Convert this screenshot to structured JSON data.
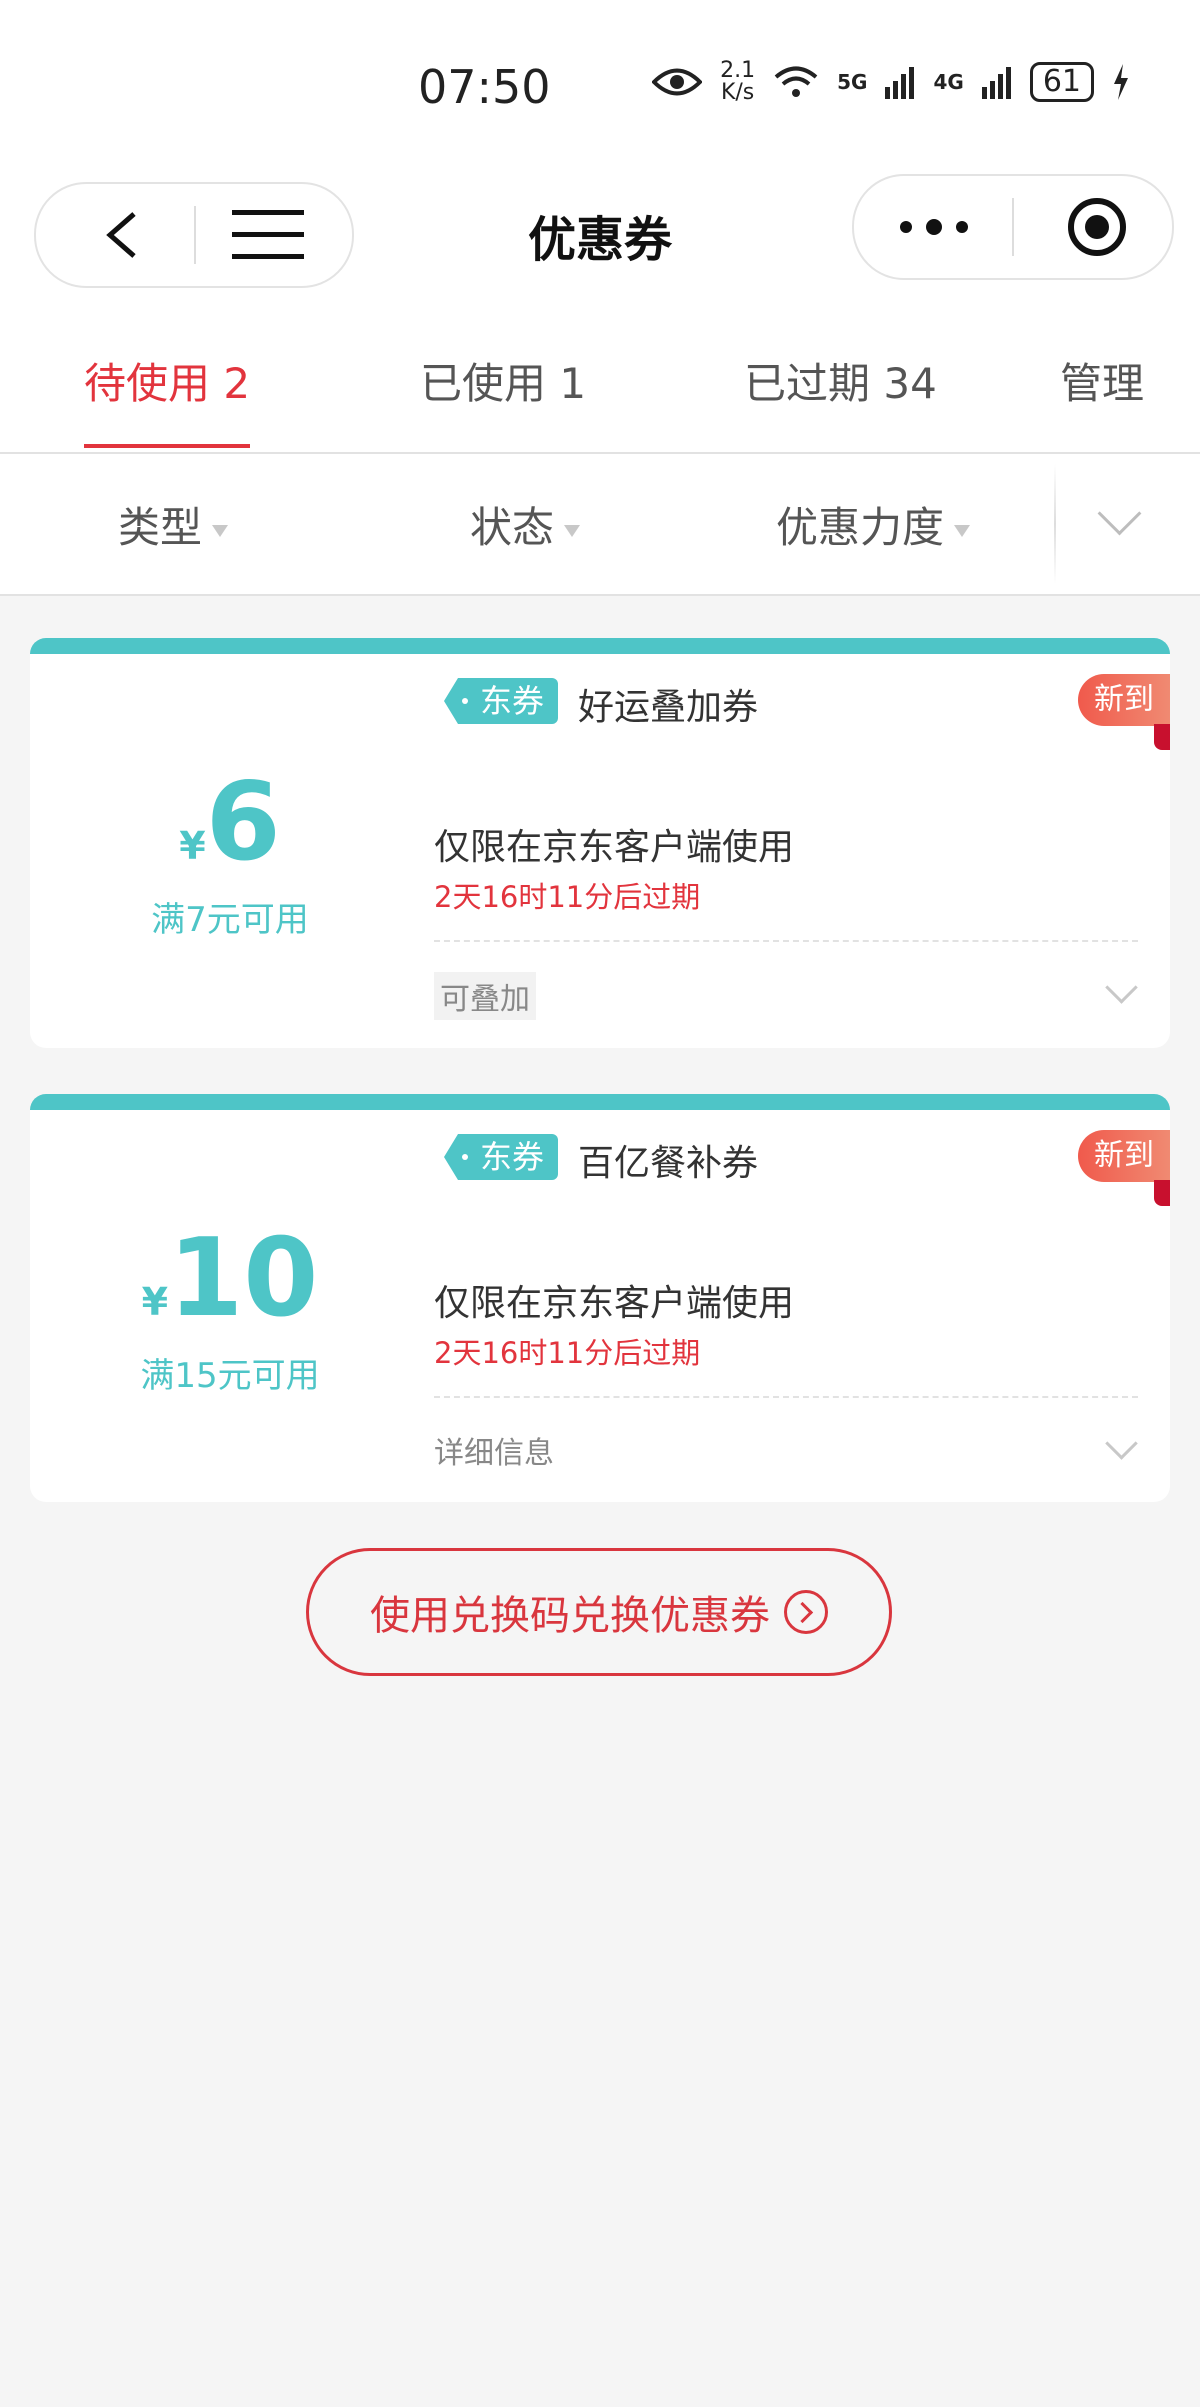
{
  "status_bar": {
    "time": "07:50",
    "net_speed_value": "2.1",
    "net_speed_unit": "K/s",
    "signal_5g": "5G",
    "signal_4g": "4G",
    "battery": "61"
  },
  "nav": {
    "title": "优惠券",
    "icons": [
      "back-icon",
      "menu-icon",
      "more-icon",
      "target-icon"
    ]
  },
  "tabs": [
    {
      "label": "待使用 2",
      "active": true
    },
    {
      "label": "已使用 1",
      "active": false
    },
    {
      "label": "已过期 34",
      "active": false
    },
    {
      "label": "管理",
      "active": false
    }
  ],
  "filters": [
    "类型",
    "状态",
    "优惠力度"
  ],
  "coupons": [
    {
      "tag": "东券",
      "name": "好运叠加券",
      "badge": "新到",
      "currency": "¥",
      "amount": "6",
      "condition": "满7元可用",
      "desc": "仅限在京东客户端使用",
      "expire": "2天16时11分后过期",
      "footer": "可叠加"
    },
    {
      "tag": "东券",
      "name": "百亿餐补券",
      "badge": "新到",
      "currency": "¥",
      "amount": "10",
      "condition": "满15元可用",
      "desc": "仅限在京东客户端使用",
      "expire": "2天16时11分后过期",
      "footer": "详细信息"
    }
  ],
  "redeem_label": "使用兑换码兑换优惠券",
  "colors": {
    "accent_red": "#e2343d",
    "teal": "#4ec5c7",
    "background": "#f5f5f5"
  }
}
